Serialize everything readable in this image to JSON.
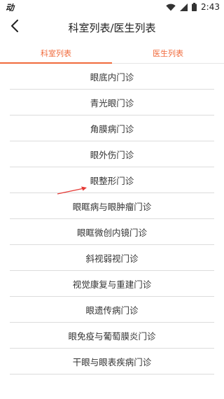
{
  "status_bar": {
    "left_text": "动",
    "time": "2:43",
    "icons": [
      "wifi-icon",
      "signal-icon",
      "battery-icon"
    ]
  },
  "header": {
    "title": "科室列表/医生列表",
    "back_icon": "chevron-left-icon"
  },
  "tabs": [
    {
      "label": "科室列表",
      "active": true
    },
    {
      "label": "医生列表",
      "active": false
    }
  ],
  "departments": [
    "眼底内门诊",
    "青光眼门诊",
    "角膜病门诊",
    "眼外伤门诊",
    "眼整形门诊",
    "眼眶病与眼肿瘤门诊",
    "眼眶微创内镜门诊",
    "斜视弱视门诊",
    "视觉康复与重建门诊",
    "眼遗传病门诊",
    "眼免疫与葡萄膜炎门诊",
    "干眼与眼表疾病门诊"
  ],
  "colors": {
    "accent": "#f06a3b",
    "annotation_arrow": "#e53935"
  }
}
